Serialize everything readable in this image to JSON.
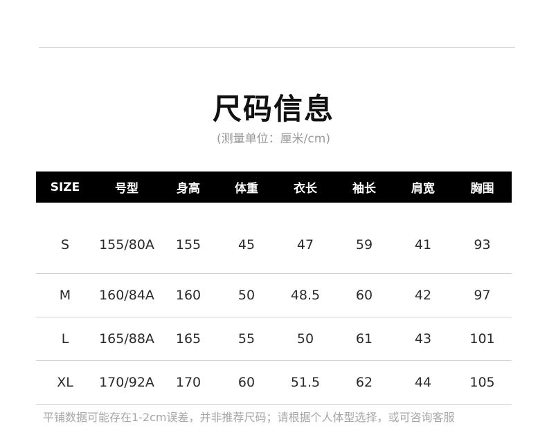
{
  "title": "尺码信息",
  "subtitle": "(测量单位：厘米/cm)",
  "table": {
    "headers": [
      "SIZE",
      "号型",
      "身高",
      "体重",
      "衣长",
      "袖长",
      "肩宽",
      "胸围"
    ],
    "rows": [
      [
        "S",
        "155/80A",
        "155",
        "45",
        "47",
        "59",
        "41",
        "93"
      ],
      [
        "M",
        "160/84A",
        "160",
        "50",
        "48.5",
        "60",
        "42",
        "97"
      ],
      [
        "L",
        "165/88A",
        "165",
        "55",
        "50",
        "61",
        "43",
        "101"
      ],
      [
        "XL",
        "170/92A",
        "170",
        "60",
        "51.5",
        "62",
        "44",
        "105"
      ]
    ]
  },
  "footnote": "平铺数据可能存在1-2cm误差，并非推荐尺码；请根据个人体型选择，或可咨询客服"
}
